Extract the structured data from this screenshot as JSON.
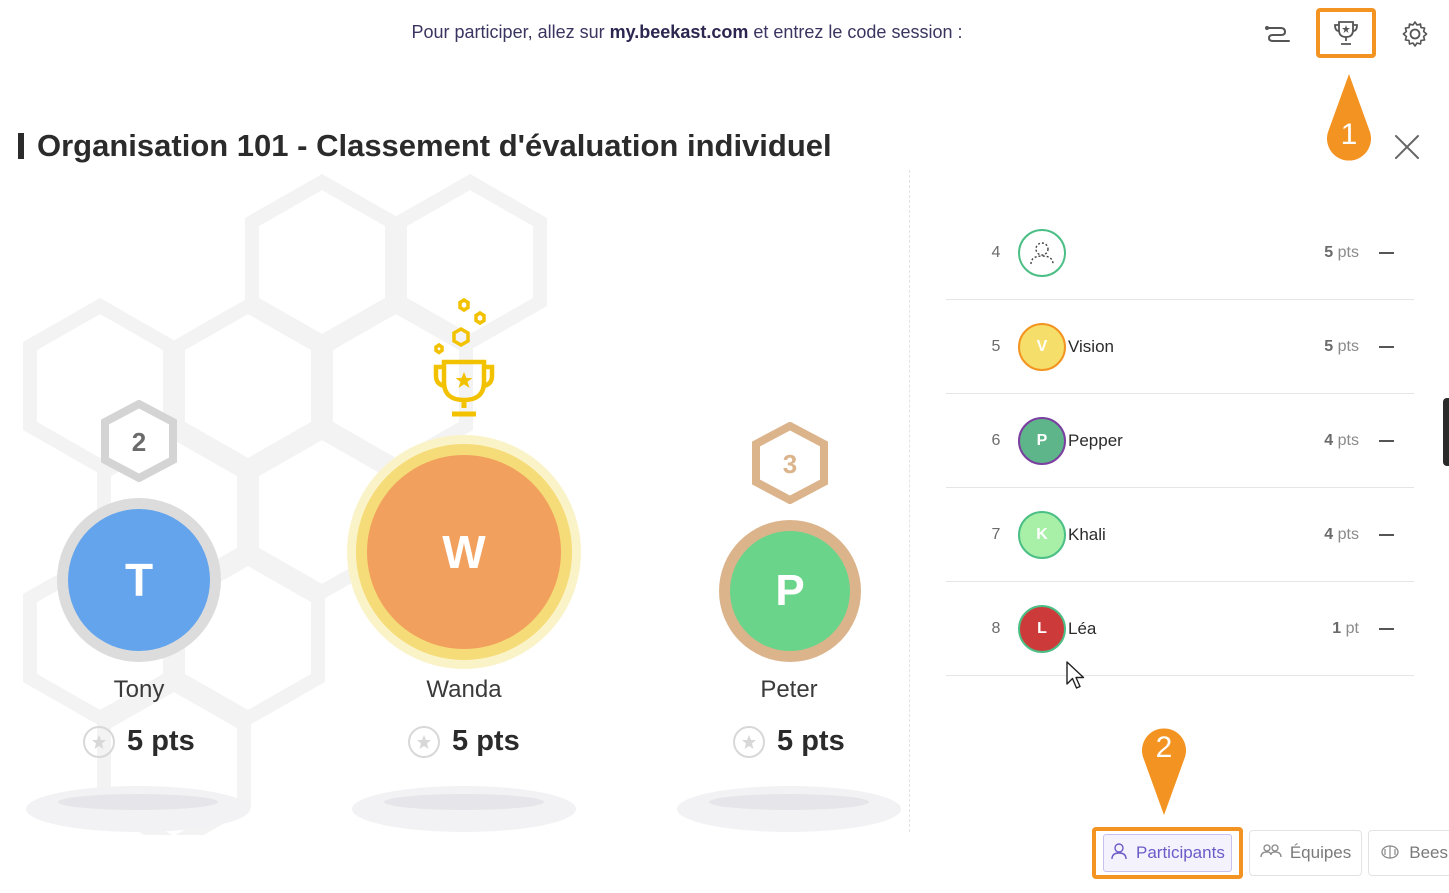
{
  "header": {
    "session_prefix": "Pour participer, allez sur ",
    "session_site": "my.beekast.com",
    "session_suffix": " et entrez le code session :"
  },
  "icons": {
    "ranking": "ranking-icon",
    "trophy": "trophy-icon",
    "settings": "gear-icon"
  },
  "markers": {
    "one": "1",
    "two": "2"
  },
  "title": "Organisation 101 - Classement d'évaluation individuel",
  "podium": [
    {
      "rank": "2",
      "initial": "T",
      "name": "Tony",
      "pts_value": "5",
      "pts_unit": "pts",
      "color": "#63a4ec",
      "ring": "#dcdcdc"
    },
    {
      "rank": "1",
      "initial": "W",
      "name": "Wanda",
      "pts_value": "5",
      "pts_unit": "pts",
      "color": "#f2a05e",
      "ring": "#f5dc78"
    },
    {
      "rank": "3",
      "initial": "P",
      "name": "Peter",
      "pts_value": "5",
      "pts_unit": "pts",
      "color": "#69d48a",
      "ring": "#dbb48c"
    }
  ],
  "ranking": [
    {
      "rank": "4",
      "initial": "",
      "name": "",
      "pts_value": "5",
      "pts_unit": "pts",
      "color": "#ffffff",
      "border": "#4bbf85"
    },
    {
      "rank": "5",
      "initial": "V",
      "name": "Vision",
      "pts_value": "5",
      "pts_unit": "pts",
      "color": "#f5df6a",
      "border": "#f39321"
    },
    {
      "rank": "6",
      "initial": "P",
      "name": "Pepper",
      "pts_value": "4",
      "pts_unit": "pts",
      "color": "#5fb58a",
      "border": "#7b3fa0"
    },
    {
      "rank": "7",
      "initial": "K",
      "name": "Khali",
      "pts_value": "4",
      "pts_unit": "pts",
      "color": "#a8f0a8",
      "border": "#4bbf85"
    },
    {
      "rank": "8",
      "initial": "L",
      "name": "Léa",
      "pts_value": "1",
      "pts_unit": "pt",
      "color": "#cc3a3a",
      "border": "#4bbf85"
    }
  ],
  "tabs": [
    {
      "label": "Participants",
      "icon": "user-icon",
      "active": true
    },
    {
      "label": "Équipes",
      "icon": "users-icon",
      "active": false
    },
    {
      "label": "Bees",
      "icon": "bee-icon",
      "active": false
    }
  ],
  "colors": {
    "accent": "#f39321",
    "tab_active": "#6b5bc8",
    "trophy": "#f2c200"
  }
}
